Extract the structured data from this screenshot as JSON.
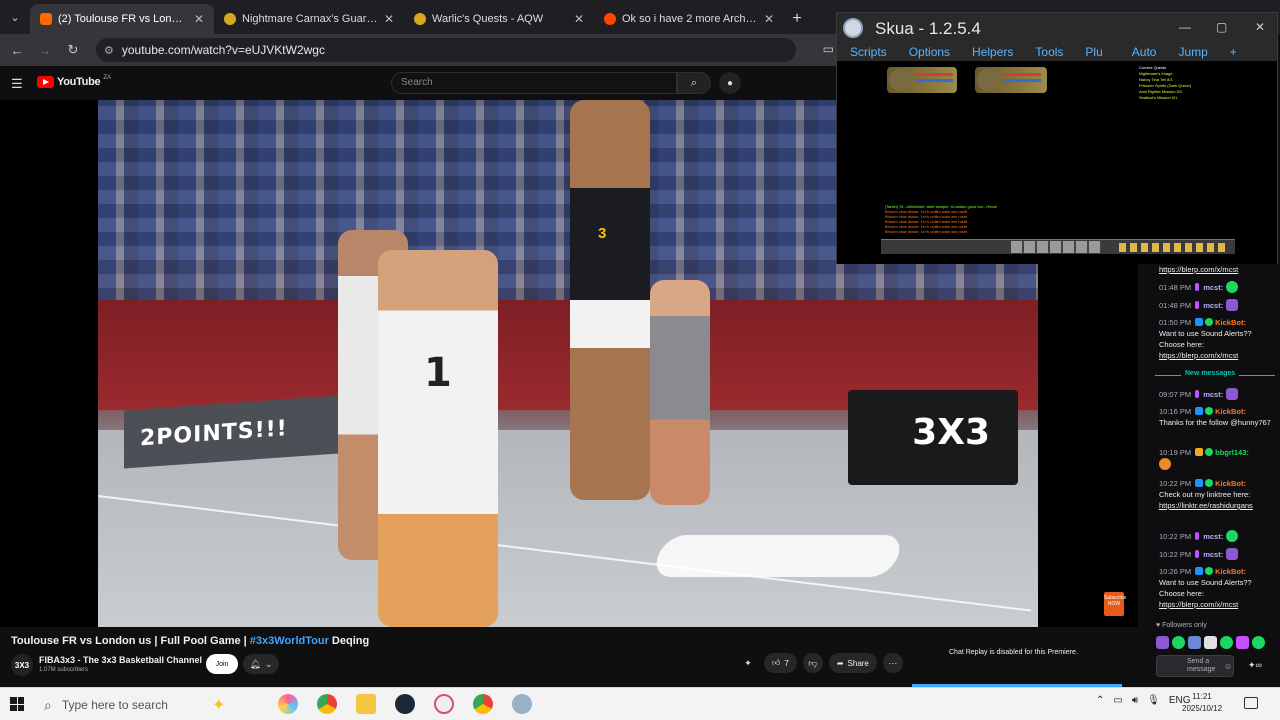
{
  "browser": {
    "tabs": [
      {
        "label": "(2) Toulouse FR vs London us",
        "favicon_color": "#ff6a00",
        "active": true
      },
      {
        "label": "Nightmare Carnax's Guardians",
        "favicon_color": "#d8a91c",
        "active": false
      },
      {
        "label": "Warlic's Quests - AQW",
        "favicon_color": "#d8a91c",
        "active": false
      },
      {
        "label": "Ok so i have 2 more ArchMage",
        "favicon_color": "#ff4500",
        "active": false
      }
    ],
    "url": "youtube.com/watch?v=eUJVKtW2wgc"
  },
  "youtube": {
    "logo_text": "YouTube",
    "country_code": "ZA",
    "search_placeholder": "Search",
    "video": {
      "overlay_text": "2POINTS!!!",
      "jersey_number_front": "1",
      "jersey_number_back": "3",
      "table_logo": "3X3",
      "title_main": "Toulouse FR vs London us | Full Pool Game | ",
      "title_tag": "#3x3WorldTour",
      "title_suffix": " Deqing",
      "channel_avatar": "3X3",
      "channel_name": "FIBA3x3 - The 3x3 Basketball Channel",
      "subscribers": "1.07M subscribers",
      "join_label": "Join",
      "like_count": "7",
      "share_label": "Share",
      "chat_replay_note": "Chat Replay is disabled for this Premiere.",
      "watermark_text": "Subscribe NOW"
    }
  },
  "skua": {
    "title": "Skua - 1.2.5.4",
    "menu": [
      "Scripts",
      "Options",
      "Helpers",
      "Tools",
      "Plu",
      "Auto",
      "Jump"
    ],
    "add_label": "+",
    "quest_header": "Current Quests",
    "quest_lines": [
      "Nightmare's Image",
      "Nancy Tina Tell 8/1",
      "Prisoner Spirits (Dark Quiver)",
      "Amil Righter Mission 0/1",
      "Sealicut's Mission 0/1"
    ],
    "chat_lines": [
      "[Tarkin] Tit...######## :alert sample: Ul.andko good fun...Hinde",
      "Bhoom vlow dlown: 1s+k unllim wain win rostit",
      "Bhoom vlow dlown: 1s+k unllim wain win rostit",
      "Bhoom vlow dlown: 1s+k unllim wain win rostit",
      "Bhoom vlow dlown: 1s+k unllim wain win rostit",
      "Bhoom vlow dlown: 1s+k unllim wain win rostit"
    ],
    "accent_color": "#5ab4ff"
  },
  "chat": {
    "messages": [
      {
        "time": "",
        "badges": [],
        "user": "",
        "text": "",
        "link": "https://blerp.com/x/mcst"
      },
      {
        "time": "01:48 PM",
        "badges": [
          "#c450ff"
        ],
        "user": "mcst:",
        "user_color": "#b0b0ff",
        "emote": "#1ed760"
      },
      {
        "time": "01:48 PM",
        "badges": [
          "#c450ff"
        ],
        "user": "mcst:",
        "user_color": "#b0b0ff",
        "emote": "#1ed760"
      },
      {
        "time": "01:50 PM",
        "badges": [
          "#1e90ff",
          "#1ed760"
        ],
        "user": "KickBot:",
        "user_color": "#ff7a1a",
        "text": "Want to use Sound Alerts?? Choose here:",
        "link": "https://blerp.com/x/mcst"
      },
      {
        "time": "09:07 PM",
        "badges": [
          "#c450ff"
        ],
        "user": "mcst:",
        "user_color": "#b0b0ff",
        "emote": "#8a5ad6"
      },
      {
        "time": "10:16 PM",
        "badges": [
          "#1e90ff",
          "#1ed760"
        ],
        "user": "KickBot:",
        "user_color": "#ff7a1a",
        "text": "Thanks for the follow @hunny767"
      },
      {
        "time": "10:19 PM",
        "badges": [
          "#f5a623"
        ],
        "user": "bbgrl143:",
        "user_color": "#1ed760",
        "emote": "#f08a24"
      },
      {
        "time": "10:22 PM",
        "badges": [
          "#1e90ff",
          "#1ed760"
        ],
        "user": "KickBot:",
        "user_color": "#ff7a1a",
        "text": "Check out my linktree here:",
        "link": "https://linktr.ee/rashidurgans"
      },
      {
        "time": "10:22 PM",
        "badges": [
          "#c450ff"
        ],
        "user": "mcst:",
        "user_color": "#b0b0ff",
        "emote": "#1ed760"
      },
      {
        "time": "10:22 PM",
        "badges": [
          "#c450ff"
        ],
        "user": "mcst:",
        "user_color": "#b0b0ff",
        "emote": "#8a5ad6"
      },
      {
        "time": "10:26 PM",
        "badges": [
          "#1e90ff",
          "#1ed760"
        ],
        "user": "KickBot:",
        "user_color": "#ff7a1a",
        "text": "Want to use Sound Alerts?? Choose here:",
        "link": "https://blerp.com/x/mcst"
      }
    ],
    "new_messages_label": "New messages",
    "followers_only": "Followers only",
    "send_placeholder": "Send a message",
    "divider_color": "#00c8af"
  },
  "taskbar": {
    "search_placeholder": "Type here to search",
    "language": "ENG",
    "time": "11:21",
    "date": "2025/10/12"
  }
}
